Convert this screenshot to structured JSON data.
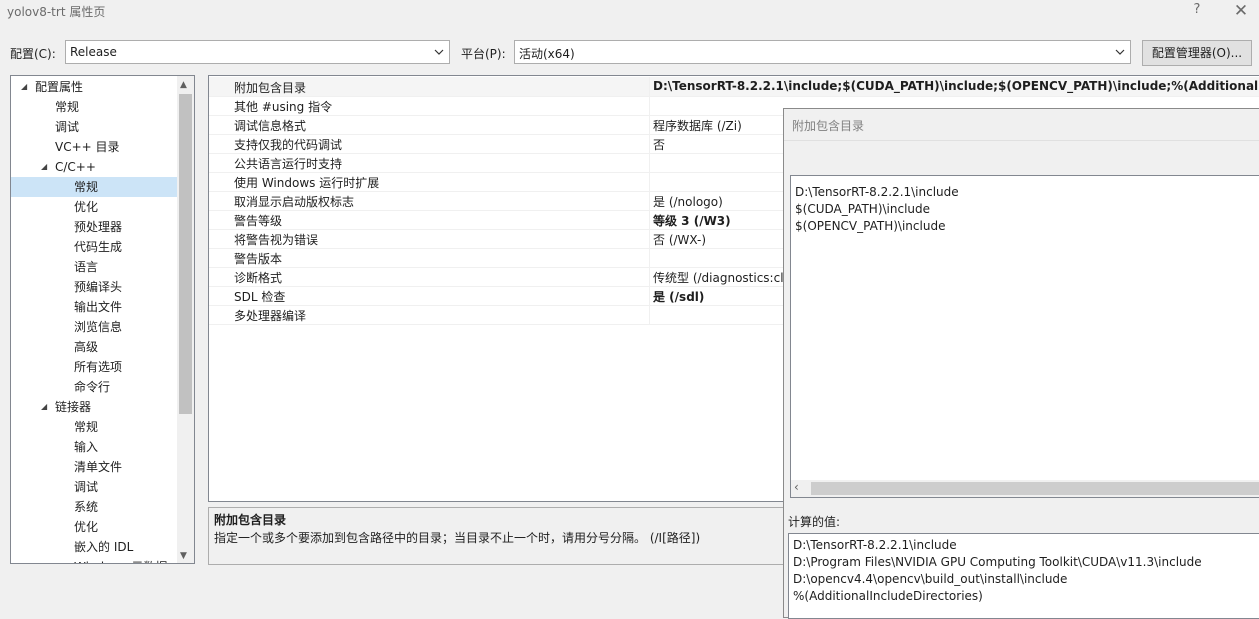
{
  "window": {
    "title": "yolov8-trt 属性页",
    "help": "?",
    "close": "✕"
  },
  "toolbar": {
    "config_label": "配置(C):",
    "config_value": "Release",
    "platform_label": "平台(P):",
    "platform_value": "活动(x64)",
    "config_manager": "配置管理器(O)..."
  },
  "tree": {
    "items": [
      {
        "label": "配置属性",
        "level": 0,
        "expanded": true
      },
      {
        "label": "常规",
        "level": 1
      },
      {
        "label": "调试",
        "level": 1
      },
      {
        "label": "VC++ 目录",
        "level": 1
      },
      {
        "label": "C/C++",
        "level": 1,
        "expanded": true
      },
      {
        "label": "常规",
        "level": 2,
        "selected": true
      },
      {
        "label": "优化",
        "level": 2
      },
      {
        "label": "预处理器",
        "level": 2
      },
      {
        "label": "代码生成",
        "level": 2
      },
      {
        "label": "语言",
        "level": 2
      },
      {
        "label": "预编译头",
        "level": 2
      },
      {
        "label": "输出文件",
        "level": 2
      },
      {
        "label": "浏览信息",
        "level": 2
      },
      {
        "label": "高级",
        "level": 2
      },
      {
        "label": "所有选项",
        "level": 2
      },
      {
        "label": "命令行",
        "level": 2
      },
      {
        "label": "链接器",
        "level": 1,
        "expanded": true
      },
      {
        "label": "常规",
        "level": 2
      },
      {
        "label": "输入",
        "level": 2
      },
      {
        "label": "清单文件",
        "level": 2
      },
      {
        "label": "调试",
        "level": 2
      },
      {
        "label": "系统",
        "level": 2
      },
      {
        "label": "优化",
        "level": 2
      },
      {
        "label": "嵌入的 IDL",
        "level": 2
      },
      {
        "label": "Windows 元数据",
        "level": 2
      }
    ]
  },
  "grid": {
    "rows": [
      {
        "name": "附加包含目录",
        "value": "D:\\TensorRT-8.2.2.1\\include;$(CUDA_PATH)\\include;$(OPENCV_PATH)\\include;%(AdditionalIncludeDirectories)",
        "bold": true
      },
      {
        "name": "其他 #using 指令",
        "value": ""
      },
      {
        "name": "调试信息格式",
        "value": "程序数据库 (/Zi)"
      },
      {
        "name": "支持仅我的代码调试",
        "value": "否"
      },
      {
        "name": "公共语言运行时支持",
        "value": ""
      },
      {
        "name": "使用 Windows 运行时扩展",
        "value": ""
      },
      {
        "name": "取消显示启动版权标志",
        "value": "是 (/nologo)"
      },
      {
        "name": "警告等级",
        "value": "等级 3 (/W3)",
        "bold": true
      },
      {
        "name": "将警告视为错误",
        "value": "否 (/WX-)"
      },
      {
        "name": "警告版本",
        "value": ""
      },
      {
        "name": "诊断格式",
        "value": "传统型 (/diagnostics:classic)"
      },
      {
        "name": "SDL 检查",
        "value": "是 (/sdl)",
        "bold": true
      },
      {
        "name": "多处理器编译",
        "value": ""
      }
    ]
  },
  "description": {
    "title": "附加包含目录",
    "text": "指定一个或多个要添加到包含路径中的目录；当目录不止一个时，请用分号分隔。      (/I[路径])"
  },
  "dialog": {
    "title": "附加包含目录",
    "lines": [
      "D:\\TensorRT-8.2.2.1\\include",
      "$(CUDA_PATH)\\include",
      "$(OPENCV_PATH)\\include"
    ],
    "computed_label": "计算的值:",
    "computed": [
      "D:\\TensorRT-8.2.2.1\\include",
      "D:\\Program Files\\NVIDIA GPU Computing Toolkit\\CUDA\\v11.3\\include",
      "D:\\opencv4.4\\opencv\\build_out\\install\\include",
      "%(AdditionalIncludeDirectories)"
    ]
  }
}
